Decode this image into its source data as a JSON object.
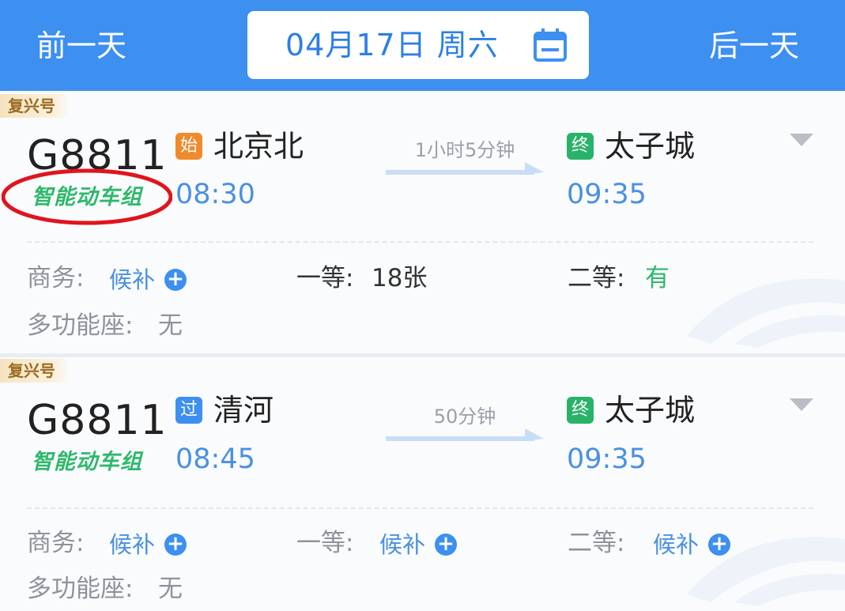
{
  "header": {
    "prev_day": "前一天",
    "next_day": "后一天",
    "date": "04月17日 周六",
    "calendar_icon": "calendar-icon"
  },
  "trains": [
    {
      "brand": "复兴号",
      "number": "G8811",
      "smart_label": "智能动车组",
      "from_badge": "始",
      "from_station": "北京北",
      "depart_time": "08:30",
      "duration": "1小时5分钟",
      "to_badge": "终",
      "to_station": "太子城",
      "arrive_time": "09:35",
      "seats": {
        "business_label": "商务:",
        "business_value": "候补",
        "first_label": "一等:",
        "first_value": "18张",
        "second_label": "二等:",
        "second_value": "有",
        "multi_label": "多功能座:",
        "multi_value": "无"
      }
    },
    {
      "brand": "复兴号",
      "number": "G8811",
      "smart_label": "智能动车组",
      "from_badge": "过",
      "from_station": "清河",
      "depart_time": "08:45",
      "duration": "50分钟",
      "to_badge": "终",
      "to_station": "太子城",
      "arrive_time": "09:35",
      "seats": {
        "business_label": "商务:",
        "business_value": "候补",
        "first_label": "一等:",
        "first_value": "候补",
        "second_label": "二等:",
        "second_value": "候补",
        "multi_label": "多功能座:",
        "multi_value": "无"
      }
    }
  ],
  "colors": {
    "header_bg": "#3d8ff0",
    "time_blue": "#4a90e2",
    "available_green": "#2fb86b",
    "start_badge": "#f08a2c",
    "highlight_red": "#e0141e"
  }
}
